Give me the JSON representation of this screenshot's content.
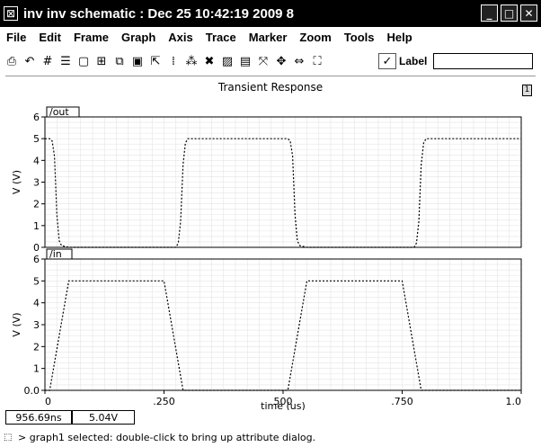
{
  "window": {
    "title": "inv inv schematic : Dec 25 10:42:19 2009 8",
    "app_icon": "x-box-icon",
    "buttons": {
      "minimize": "_",
      "maximize": "□",
      "close": "✕"
    }
  },
  "menu": {
    "items": [
      "File",
      "Edit",
      "Frame",
      "Graph",
      "Axis",
      "Trace",
      "Marker",
      "Zoom",
      "Tools",
      "Help"
    ]
  },
  "toolbar": {
    "tools": [
      {
        "name": "print-icon",
        "glyph": "⎙"
      },
      {
        "name": "undo-icon",
        "glyph": "↶"
      },
      {
        "name": "grid-icon",
        "glyph": "#"
      },
      {
        "name": "list-icon",
        "glyph": "☰"
      },
      {
        "name": "frame-icon",
        "glyph": "▢"
      },
      {
        "name": "strip-icon",
        "glyph": "⊞"
      },
      {
        "name": "copy-icon",
        "glyph": "⧉"
      },
      {
        "name": "window-icon",
        "glyph": "▣"
      },
      {
        "name": "expand-icon",
        "glyph": "⇱"
      },
      {
        "name": "marker-icon",
        "glyph": "⁞"
      },
      {
        "name": "markers-icon",
        "glyph": "⁂"
      },
      {
        "name": "delete-icon",
        "glyph": "✖"
      },
      {
        "name": "pattern-icon",
        "glyph": "▨"
      },
      {
        "name": "calculator-icon",
        "glyph": "▤"
      },
      {
        "name": "zoom-fit-icon",
        "glyph": "⤧"
      },
      {
        "name": "zoom-y-icon",
        "glyph": "✥"
      },
      {
        "name": "zoom-x-icon",
        "glyph": "⇔"
      },
      {
        "name": "zoom-box-icon",
        "glyph": "⛶"
      }
    ],
    "label_checked": "✓",
    "label_text": "Label",
    "label_value": ""
  },
  "graph": {
    "title": "Transient Response",
    "subwindow_badge": "1"
  },
  "chart_data": {
    "type": "line",
    "xlabel": "time (us)",
    "xlim": [
      0,
      1.0
    ],
    "x_ticks": [
      "0",
      ".250",
      "500",
      ".750",
      "1.0"
    ],
    "grid": true,
    "strips": [
      {
        "trace_label": "/out",
        "ylabel": "V (V)",
        "ylim": [
          0,
          6
        ],
        "y_ticks": [
          "0",
          "1",
          "2",
          "3",
          "4",
          "5",
          "6"
        ],
        "x": [
          0,
          0.01,
          0.015,
          0.02,
          0.025,
          0.03,
          0.035,
          0.05,
          0.25,
          0.275,
          0.28,
          0.285,
          0.29,
          0.295,
          0.3,
          0.31,
          0.5,
          0.51,
          0.515,
          0.52,
          0.525,
          0.53,
          0.535,
          0.55,
          0.75,
          0.775,
          0.78,
          0.785,
          0.79,
          0.795,
          0.8,
          0.81,
          1.0
        ],
        "y": [
          5,
          5,
          4.9,
          4.2,
          1.5,
          0.3,
          0.08,
          0,
          0,
          0,
          0.2,
          1.2,
          3.8,
          4.8,
          5,
          5,
          5,
          5,
          4.9,
          4.2,
          1.5,
          0.3,
          0.08,
          0,
          0,
          0,
          0.2,
          1.2,
          3.8,
          4.8,
          5,
          5,
          5
        ]
      },
      {
        "trace_label": "/in",
        "ylabel": "V (V)",
        "ylim": [
          0,
          6
        ],
        "y_ticks": [
          "0.0",
          "1",
          "2",
          "3",
          "4",
          "5",
          "6"
        ],
        "x": [
          0,
          0.01,
          0.05,
          0.25,
          0.29,
          0.5,
          0.51,
          0.55,
          0.75,
          0.79,
          1.0
        ],
        "y": [
          0,
          0,
          5,
          5,
          0,
          0,
          0,
          5,
          5,
          0,
          0
        ]
      }
    ]
  },
  "cursor": {
    "time": "956.69ns",
    "value": "5.04V"
  },
  "status": {
    "icon": "pointer-icon",
    "message": "> graph1 selected: double-click to bring up attribute dialog."
  }
}
